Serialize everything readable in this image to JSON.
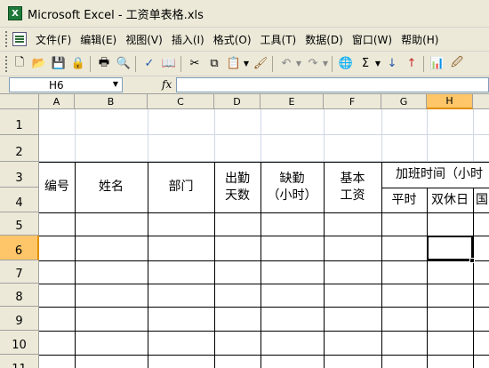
{
  "window": {
    "title": "Microsoft Excel - 工资单表格.xls"
  },
  "menu": {
    "items": [
      "文件(F)",
      "编辑(E)",
      "视图(V)",
      "插入(I)",
      "格式(O)",
      "工具(T)",
      "数据(D)",
      "窗口(W)",
      "帮助(H)"
    ]
  },
  "formula_bar": {
    "name_box": "H6",
    "fx": "fx",
    "content": ""
  },
  "sheet": {
    "columns": [
      "A",
      "B",
      "C",
      "D",
      "E",
      "F",
      "G",
      "H",
      "I"
    ],
    "active_column": "H",
    "rows": [
      "1",
      "2",
      "3",
      "4",
      "5",
      "6",
      "7",
      "8",
      "9",
      "10",
      "11"
    ],
    "active_row": "6",
    "headers": {
      "a": "编号",
      "b": "姓名",
      "c": "部门",
      "d": "出勤\n天数",
      "e": "缺勤\n（小时）",
      "f": "基本\n工资",
      "overtime": "加班时间（小时",
      "g": "平时",
      "h": "双休日",
      "i": "国"
    }
  },
  "icons": [
    "excel-app-icon",
    "workbook-icon",
    "new-icon",
    "open-icon",
    "save-icon",
    "permission-icon",
    "print-icon",
    "print-preview-icon",
    "spelling-icon",
    "research-icon",
    "cut-icon",
    "copy-icon",
    "paste-icon",
    "format-painter-icon",
    "undo-icon",
    "redo-icon",
    "hyperlink-icon",
    "autosum-icon",
    "sort-ascending-icon",
    "sort-descending-icon",
    "chart-wizard-icon",
    "drawing-icon"
  ]
}
